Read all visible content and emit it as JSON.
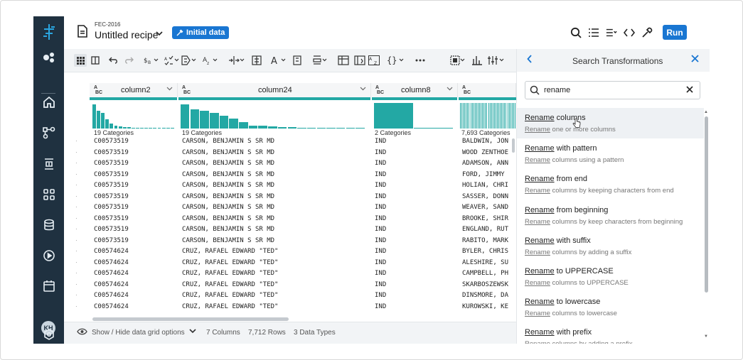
{
  "header": {
    "flow_name": "FEC-2016",
    "recipe_title": "Untitled recipe",
    "sample_badge": "Initial data",
    "run_label": "Run"
  },
  "nav": {
    "avatar_initials": "KH",
    "icons": [
      "logo-icon",
      "datasets-icon",
      "home-icon",
      "flows-icon",
      "jobs-icon",
      "library-icon",
      "database-icon",
      "plans-icon",
      "schedule-icon",
      "settings-icon"
    ]
  },
  "grid": {
    "columns": [
      {
        "name": "column2",
        "type": "ABC",
        "categories": "19 Categories",
        "hist": [
          0.95,
          0.7,
          0.6,
          0.35,
          0.2,
          0.1,
          0.08,
          0.06,
          0.05,
          0.04,
          0.03,
          0.03,
          0.02,
          0.02,
          0.02,
          0.01,
          0.01,
          0.01,
          0.01
        ]
      },
      {
        "name": "column24",
        "type": "ABC",
        "categories": "19 Categories",
        "hist": [
          0.95,
          0.75,
          0.7,
          0.6,
          0.5,
          0.4,
          0.25,
          0.12,
          0.1,
          0.08,
          0.06,
          0.05,
          0.04,
          0.03,
          0.02,
          0.02,
          0.02,
          0.01,
          0.01
        ]
      },
      {
        "name": "column8",
        "type": "ABC",
        "categories": "2 Categories",
        "hist": [
          1.0,
          0.03
        ]
      },
      {
        "name": "",
        "type": "ABC",
        "categories": "7,693 Categories",
        "hist": [
          1,
          1,
          1,
          1,
          1,
          1,
          1,
          1,
          1,
          1,
          1,
          1,
          1,
          1,
          1,
          1,
          1,
          1,
          1,
          1,
          1,
          1,
          1,
          1,
          1,
          1,
          1,
          1,
          1,
          1,
          1,
          1,
          1,
          1,
          1,
          1,
          1,
          1
        ]
      }
    ],
    "rows": [
      [
        "C00573519",
        "CARSON, BENJAMIN S SR MD",
        "IND",
        "BALDWIN, JON"
      ],
      [
        "C00573519",
        "CARSON, BENJAMIN S SR MD",
        "IND",
        "WOOD ZENTHOE"
      ],
      [
        "C00573519",
        "CARSON, BENJAMIN S SR MD",
        "IND",
        "ADAMSON, ANN"
      ],
      [
        "C00573519",
        "CARSON, BENJAMIN S SR MD",
        "IND",
        "FORD, JIMMY"
      ],
      [
        "C00573519",
        "CARSON, BENJAMIN S SR MD",
        "IND",
        "HOLIAN, CHRI"
      ],
      [
        "C00573519",
        "CARSON, BENJAMIN S SR MD",
        "IND",
        "SASSER, DONN"
      ],
      [
        "C00573519",
        "CARSON, BENJAMIN S SR MD",
        "IND",
        "WEAVER, SAND"
      ],
      [
        "C00573519",
        "CARSON, BENJAMIN S SR MD",
        "IND",
        "BROOKE, SHIR"
      ],
      [
        "C00573519",
        "CARSON, BENJAMIN S SR MD",
        "IND",
        "ENGLAND, RUT"
      ],
      [
        "C00573519",
        "CARSON, BENJAMIN S SR MD",
        "IND",
        "RABITO, MARK"
      ],
      [
        "C00574624",
        "CRUZ, RAFAEL EDWARD \"TED\"",
        "IND",
        "BYLER, CHRIS"
      ],
      [
        "C00574624",
        "CRUZ, RAFAEL EDWARD \"TED\"",
        "IND",
        "ALESHIRE, SU"
      ],
      [
        "C00574624",
        "CRUZ, RAFAEL EDWARD \"TED\"",
        "IND",
        "CAMPBELL, PH"
      ],
      [
        "C00574624",
        "CRUZ, RAFAEL EDWARD \"TED\"",
        "IND",
        "SKARBOSZEWSK"
      ],
      [
        "C00574624",
        "CRUZ, RAFAEL EDWARD \"TED\"",
        "IND",
        "DINSMORE, DA"
      ],
      [
        "C00574624",
        "CRUZ, RAFAEL EDWARD \"TED\"",
        "IND",
        "KUROWSKI, KE"
      ]
    ]
  },
  "footer": {
    "grid_options": "Show / Hide data grid options",
    "columns": "7 Columns",
    "rows": "7,712 Rows",
    "types": "3 Data Types"
  },
  "panel": {
    "title": "Search Transformations",
    "search_value": "rename",
    "results": [
      {
        "keyword": "Rename",
        "title_rest": " columns",
        "desc_rest": " one or more columns"
      },
      {
        "keyword": "Rename",
        "title_rest": " with pattern",
        "desc_rest": " columns using a pattern"
      },
      {
        "keyword": "Rename",
        "title_rest": " from end",
        "desc_rest": " columns by keeping characters from end"
      },
      {
        "keyword": "Rename",
        "title_rest": " from beginning",
        "desc_rest": " columns by keep characters from beginning"
      },
      {
        "keyword": "Rename",
        "title_rest": " with suffix",
        "desc_rest": " columns by adding a suffix"
      },
      {
        "keyword": "Rename",
        "title_rest": " to UPPERCASE",
        "desc_rest": " columns to UPPERCASE"
      },
      {
        "keyword": "Rename",
        "title_rest": " to lowercase",
        "desc_rest": " columns to lowercase"
      },
      {
        "keyword": "Rename",
        "title_rest": " with prefix",
        "desc_rest": " columns by adding a prefix"
      }
    ]
  }
}
